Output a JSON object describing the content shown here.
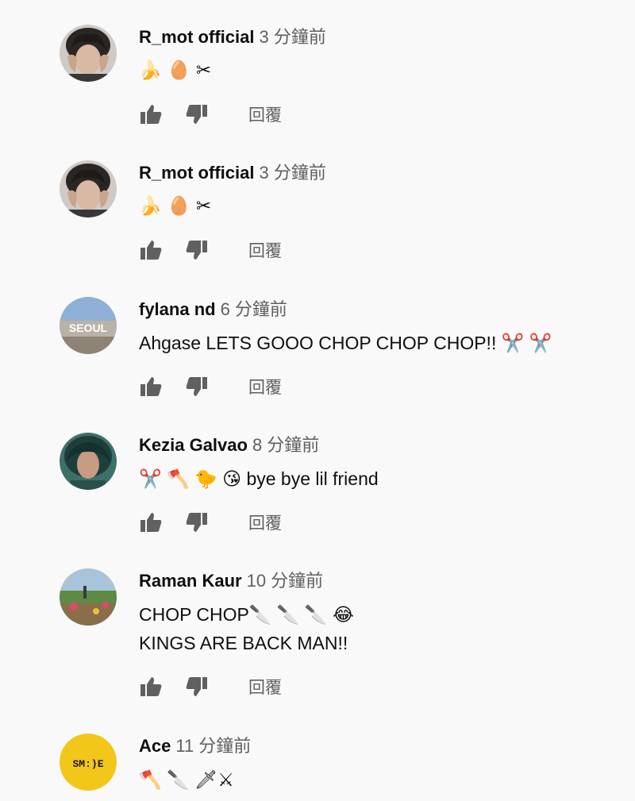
{
  "reply_label": "回覆",
  "comments": [
    {
      "author": "R_mot official",
      "time": "3 分鐘前",
      "lines": [
        "🍌 🥚 ✂"
      ]
    },
    {
      "author": "R_mot official",
      "time": "3 分鐘前",
      "lines": [
        "🍌 🥚 ✂"
      ]
    },
    {
      "author": "fylana nd",
      "time": "6 分鐘前",
      "lines": [
        "Ahgase LETS GOOO CHOP CHOP CHOP!! ✂️ ✂️"
      ]
    },
    {
      "author": "Kezia Galvao",
      "time": "8 分鐘前",
      "lines": [
        "✂️ 🪓 🐤 😘  bye bye lil friend"
      ]
    },
    {
      "author": "Raman Kaur",
      "time": "10 分鐘前",
      "lines": [
        "CHOP CHOP🔪 🔪 🔪 😂",
        "KINGS ARE BACK MAN!!"
      ]
    },
    {
      "author": "Ace",
      "time": "11 分鐘前",
      "lines": [
        "🪓 🔪 🗡⚔"
      ]
    }
  ],
  "avatar_text_ace": "SM:)E",
  "avatar_text_seoul": "SEOUL",
  "colors": {
    "background": "#f9f9f9",
    "secondary_text": "#606060",
    "icon": "#606060",
    "ace_avatar": "#f3c71a"
  }
}
